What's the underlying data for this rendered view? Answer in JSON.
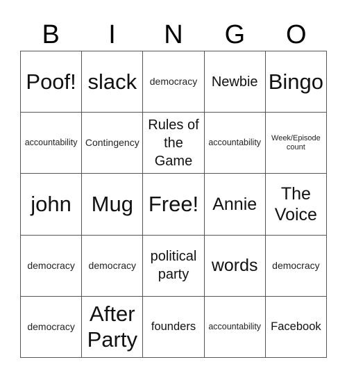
{
  "header": {
    "letters": [
      "B",
      "I",
      "N",
      "G",
      "O"
    ]
  },
  "cells": [
    {
      "text": "Poof!",
      "size": "xl"
    },
    {
      "text": "slack",
      "size": "xl"
    },
    {
      "text": "democracy",
      "size": "xs"
    },
    {
      "text": "Newbie",
      "size": "md"
    },
    {
      "text": "Bingo",
      "size": "xl"
    },
    {
      "text": "accountability",
      "size": "xxs"
    },
    {
      "text": "Contingency",
      "size": "xs"
    },
    {
      "text": "Rules of the Game",
      "size": "md"
    },
    {
      "text": "accountability",
      "size": "xxs"
    },
    {
      "text": "Week/Episode count",
      "size": "tiny"
    },
    {
      "text": "john",
      "size": "xl"
    },
    {
      "text": "Mug",
      "size": "xl"
    },
    {
      "text": "Free!",
      "size": "xl"
    },
    {
      "text": "Annie",
      "size": "lg"
    },
    {
      "text": "The Voice",
      "size": "lg"
    },
    {
      "text": "democracy",
      "size": "xs"
    },
    {
      "text": "democracy",
      "size": "xs"
    },
    {
      "text": "political party",
      "size": "md"
    },
    {
      "text": "words",
      "size": "lg"
    },
    {
      "text": "democracy",
      "size": "xs"
    },
    {
      "text": "democracy",
      "size": "xs"
    },
    {
      "text": "After Party",
      "size": "xl"
    },
    {
      "text": "founders",
      "size": "sm"
    },
    {
      "text": "accountability",
      "size": "xxs"
    },
    {
      "text": "Facebook",
      "size": "sm"
    }
  ]
}
